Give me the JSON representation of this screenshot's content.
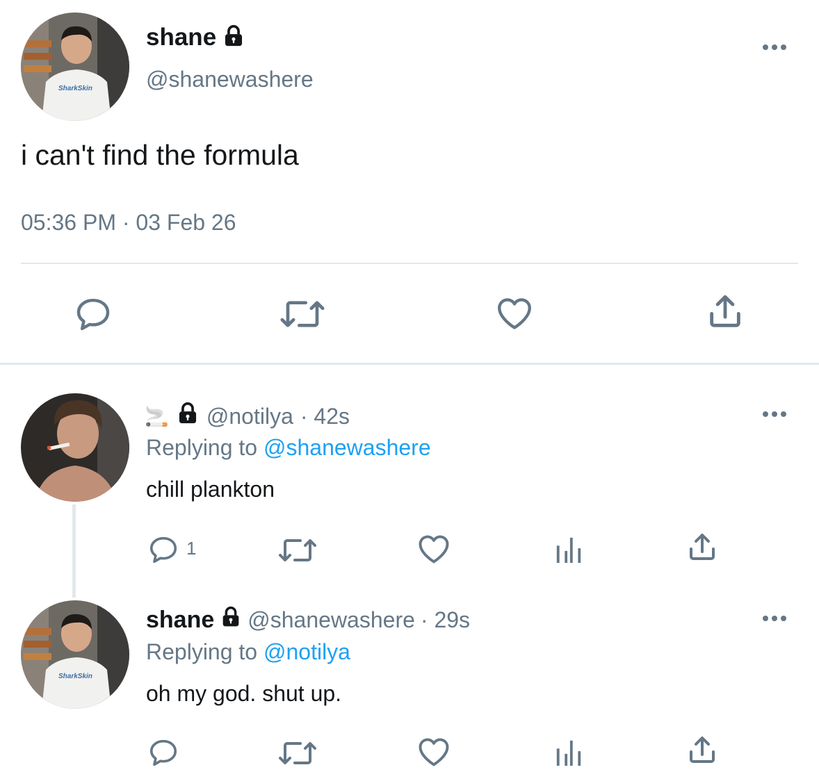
{
  "main_tweet": {
    "display_name": "shane",
    "handle": "@shanewashere",
    "text": "i can't find the formula",
    "timestamp": "05:36 PM · 03 Feb 26",
    "avatar_shirt_text": "SharkSkin"
  },
  "replies": [
    {
      "display_name_emoji": "🚬",
      "handle": "@notilya",
      "age": "· 42s",
      "replying_prefix": "Replying to",
      "replying_to": "@shanewashere",
      "text": "chill plankton",
      "reply_count": "1"
    },
    {
      "display_name": "shane",
      "handle": "@shanewashere",
      "age": "· 29s",
      "replying_prefix": "Replying to",
      "replying_to": "@notilya",
      "text": "oh my god. shut up.",
      "avatar_shirt_text": "SharkSkin"
    }
  ],
  "icons": {
    "reply": "reply-icon",
    "retweet": "retweet-icon",
    "like": "heart-icon",
    "share": "share-icon",
    "analytics": "analytics-icon",
    "more": "more-icon",
    "lock": "lock-icon"
  },
  "colors": {
    "text": "#14171a",
    "muted": "#657786",
    "link": "#1da1f2",
    "divider": "#e1e8ed"
  }
}
